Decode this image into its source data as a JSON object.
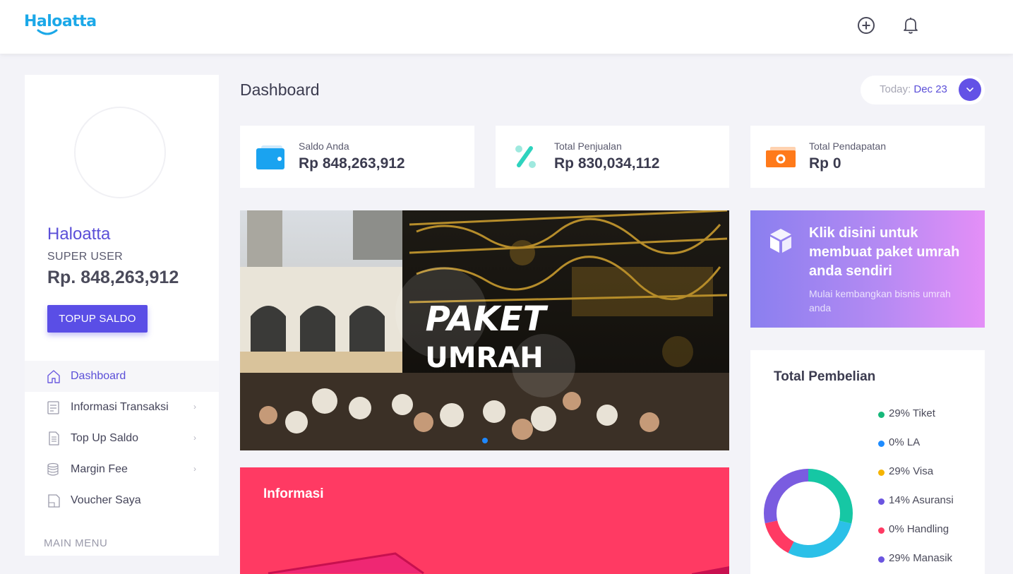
{
  "brand": {
    "logo_text": "Haloatta"
  },
  "header": {
    "add_icon": "plus-circle-icon",
    "notif_icon": "bell-icon"
  },
  "profile": {
    "name": "Haloatta",
    "role": "SUPER USER",
    "balance": "Rp. 848,263,912",
    "topup_label": "TOPUP SALDO"
  },
  "menu": {
    "items": [
      {
        "label": "Dashboard",
        "icon": "home-icon",
        "active": true,
        "has_chevron": false
      },
      {
        "label": "Informasi Transaksi",
        "icon": "receipt-icon",
        "active": false,
        "has_chevron": true
      },
      {
        "label": "Top Up Saldo",
        "icon": "document-icon",
        "active": false,
        "has_chevron": true
      },
      {
        "label": "Margin Fee",
        "icon": "coins-icon",
        "active": false,
        "has_chevron": true
      },
      {
        "label": "Voucher Saya",
        "icon": "voucher-icon",
        "active": false,
        "has_chevron": false
      }
    ],
    "section_label": "MAIN MENU",
    "chevron": "›"
  },
  "page": {
    "title": "Dashboard"
  },
  "date": {
    "label": "Today: ",
    "value": "Dec 23"
  },
  "stats": [
    {
      "label": "Saldo Anda",
      "value": "Rp 848,263,912",
      "icon": "wallet-icon",
      "color": "#1aa3f0"
    },
    {
      "label": "Total Penjualan",
      "value": "Rp 830,034,112",
      "icon": "percent-icon",
      "color": "#2ed3be"
    },
    {
      "label": "Total Pendapatan",
      "value": "Rp 0",
      "icon": "money-icon",
      "color": "#ff7a1a"
    }
  ],
  "banner": {
    "line1": "PAKET",
    "line2": "UMRAH"
  },
  "promo": {
    "title": "Klik disini untuk membuat paket umrah anda sendiri",
    "subtitle": "Mulai kembangkan bisnis umrah anda"
  },
  "info": {
    "title": "Informasi"
  },
  "purchase": {
    "title": "Total Pembelian",
    "legend": [
      {
        "label": "29% Tiket",
        "color": "#16b87a"
      },
      {
        "label": "0% LA",
        "color": "#1e8cff"
      },
      {
        "label": "29% Visa",
        "color": "#f5b400"
      },
      {
        "label": "14% Asuransi",
        "color": "#6b55e0"
      },
      {
        "label": "0% Handling",
        "color": "#ff3a63"
      },
      {
        "label": "29% Manasik",
        "color": "#6b55e0"
      }
    ]
  },
  "chart_data": {
    "type": "pie",
    "title": "Total Pembelian",
    "categories": [
      "Tiket",
      "LA",
      "Visa",
      "Asuransi",
      "Handling",
      "Manasik"
    ],
    "values": [
      29,
      0,
      29,
      14,
      0,
      29
    ],
    "colors": [
      "#16c7a4",
      "#1e8cff",
      "#2bc0e8",
      "#ff3a63",
      "#ff3a63",
      "#7a5ce0"
    ]
  }
}
